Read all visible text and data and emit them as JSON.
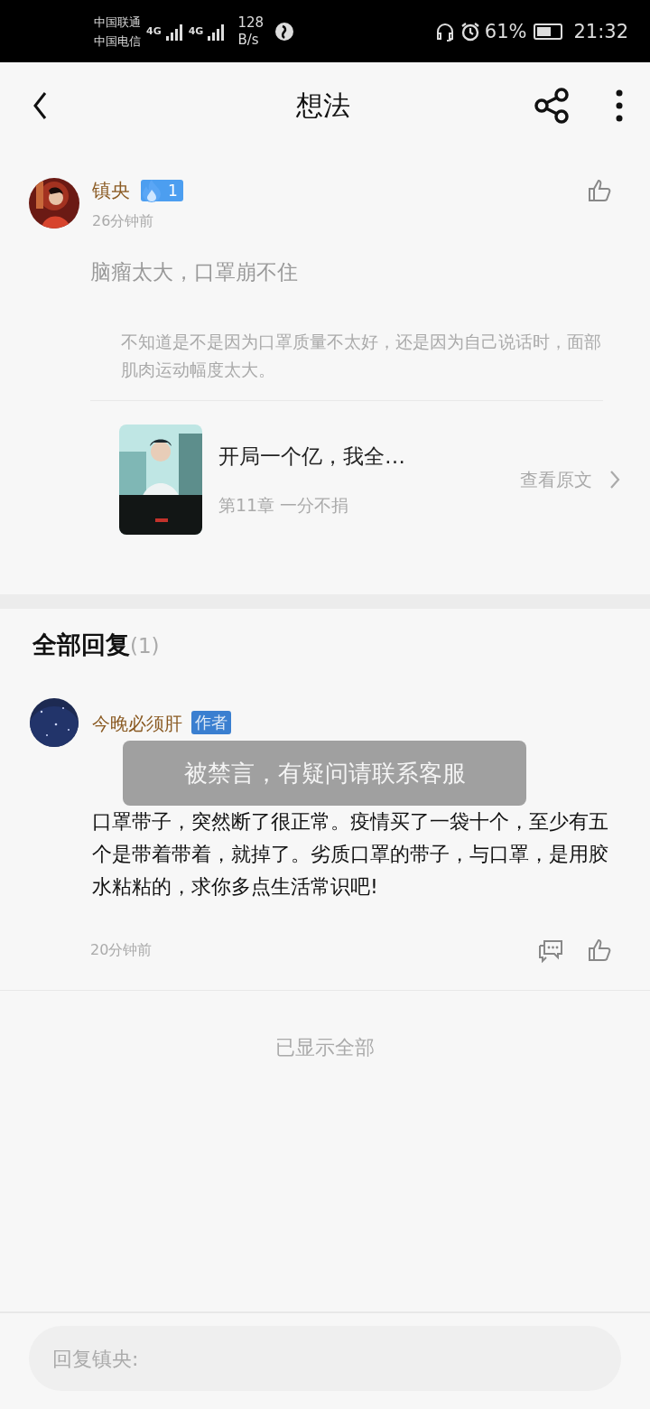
{
  "status_bar": {
    "carriers": [
      "中国联通",
      "中国电信"
    ],
    "networks": [
      "4G",
      "4G"
    ],
    "speed": [
      "128",
      "B/s"
    ],
    "battery": "61%",
    "time": "21:32"
  },
  "header": {
    "title": "想法"
  },
  "post": {
    "author": "镇央",
    "badge": "1",
    "time": "26分钟前",
    "text": "脑瘤太大，口罩崩不住",
    "quote": "不知道是不是因为口罩质量不太好，还是因为自己说话时，面部肌肉运动幅度太大。",
    "liked": false,
    "book": {
      "kind": "picture",
      "title": "开局一个亿，我全…",
      "chapter": "第11章  一分不捐",
      "link": "查看原文"
    }
  },
  "replies_header": {
    "title": "全部回复",
    "count": "(1)"
  },
  "replies": [
    {
      "author": "今晚必须肝",
      "tag": "作者",
      "text": "口罩带子，突然断了很正常。疫情买了一袋十个，至少有五个是带着带着，就掉了。劣质口罩的带子，与口罩，是用胶水粘粘的，求你多点生活常识吧!",
      "time": "20分钟前",
      "liked": false
    }
  ],
  "end_note": "已显示全部",
  "toast": "被禁言，有疑问请联系客服",
  "reply_field": {
    "placeholder": "回复镇央:"
  }
}
